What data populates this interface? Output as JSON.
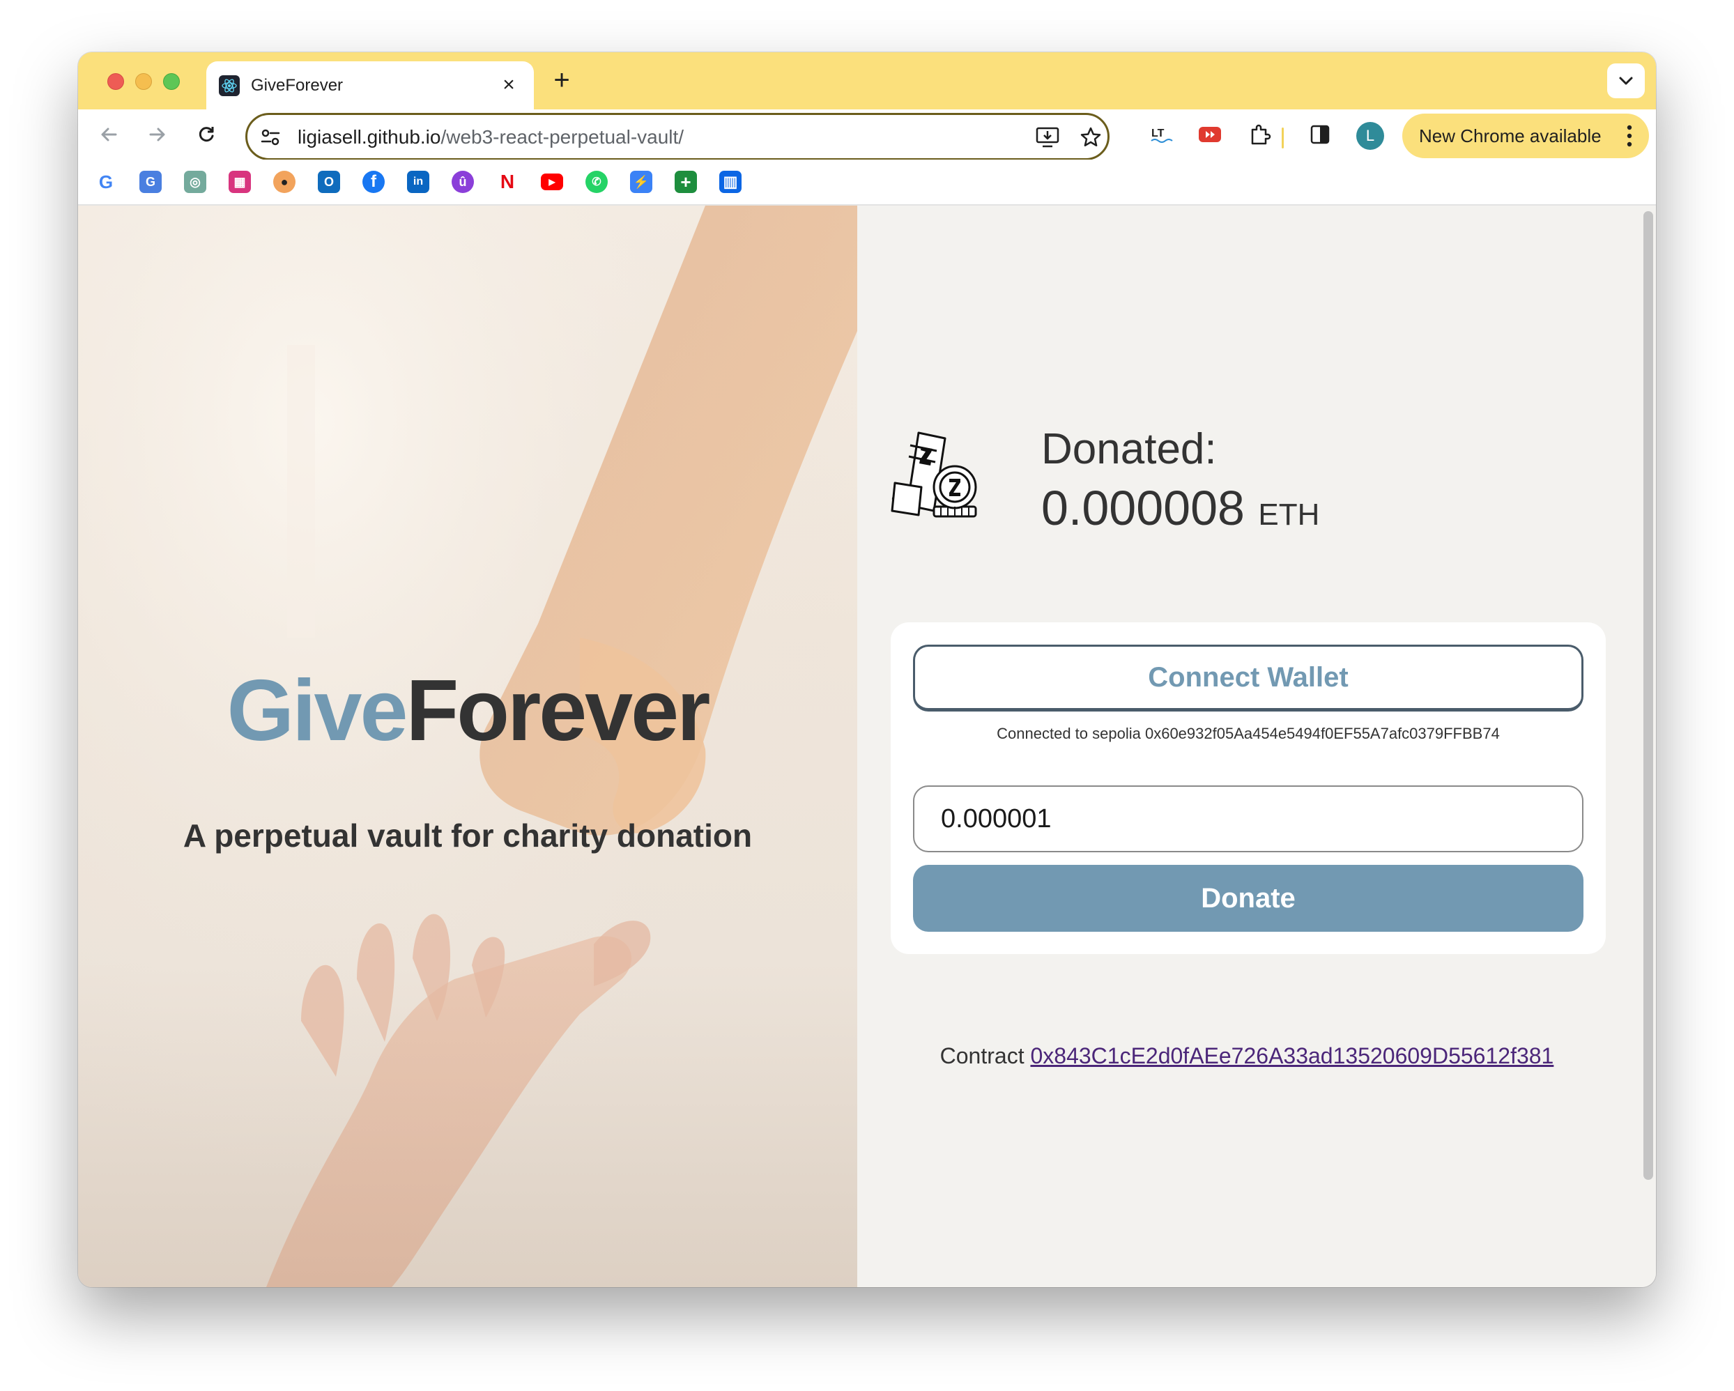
{
  "browser": {
    "tab_title": "GiveForever",
    "tab_close_glyph": "×",
    "new_tab_glyph": "+",
    "url_host": "ligiasell.github.io",
    "url_path": "/web3-react-perpetual-vault/",
    "update_label": "New Chrome available",
    "avatar_letter": "L",
    "icons": [
      "back-arrow-icon",
      "forward-arrow-icon",
      "reload-icon",
      "site-settings-icon",
      "install-app-icon",
      "bookmark-star-icon",
      "languagetool-icon",
      "youtube-ext-icon",
      "extensions-puzzle-icon",
      "side-panel-icon",
      "menu-dots-icon"
    ]
  },
  "bookmarks": [
    {
      "name": "google",
      "glyph": "G"
    },
    {
      "name": "google-translate",
      "glyph": "G"
    },
    {
      "name": "chatgpt",
      "glyph": "◎"
    },
    {
      "name": "figma-jam",
      "glyph": "▦"
    },
    {
      "name": "app-circles",
      "glyph": "●"
    },
    {
      "name": "outlook",
      "glyph": "O"
    },
    {
      "name": "facebook",
      "glyph": "f"
    },
    {
      "name": "linkedin",
      "glyph": "in"
    },
    {
      "name": "udemy",
      "glyph": "û"
    },
    {
      "name": "netflix",
      "glyph": "N"
    },
    {
      "name": "youtube",
      "glyph": "▶"
    },
    {
      "name": "whatsapp",
      "glyph": "✆"
    },
    {
      "name": "bolt",
      "glyph": "⚡"
    },
    {
      "name": "google-sheets",
      "glyph": "+"
    },
    {
      "name": "trello",
      "glyph": "▥"
    }
  ],
  "hero": {
    "title_part1": "Give",
    "title_part2": "Forever",
    "subtitle": "A perpetual vault for charity donation"
  },
  "donation": {
    "label": "Donated:",
    "amount": "0.000008",
    "unit": "ETH"
  },
  "wallet": {
    "connect_label": "Connect Wallet",
    "connected_text": "Connected to sepolia 0x60e932f05Aa454e5494f0EF55A7afc0379FFBB74",
    "amount_value": "0.000001",
    "donate_label": "Donate"
  },
  "contract": {
    "prefix": "Contract",
    "address": "0x843C1cE2d0fAEe726A33ad13520609D55612f381"
  },
  "colors": {
    "accent": "#7299b2",
    "dark_text": "#333333",
    "chrome_yellow": "#fbe07c",
    "link_visited": "#4b2679",
    "panel_bg": "#f3f2ef"
  }
}
